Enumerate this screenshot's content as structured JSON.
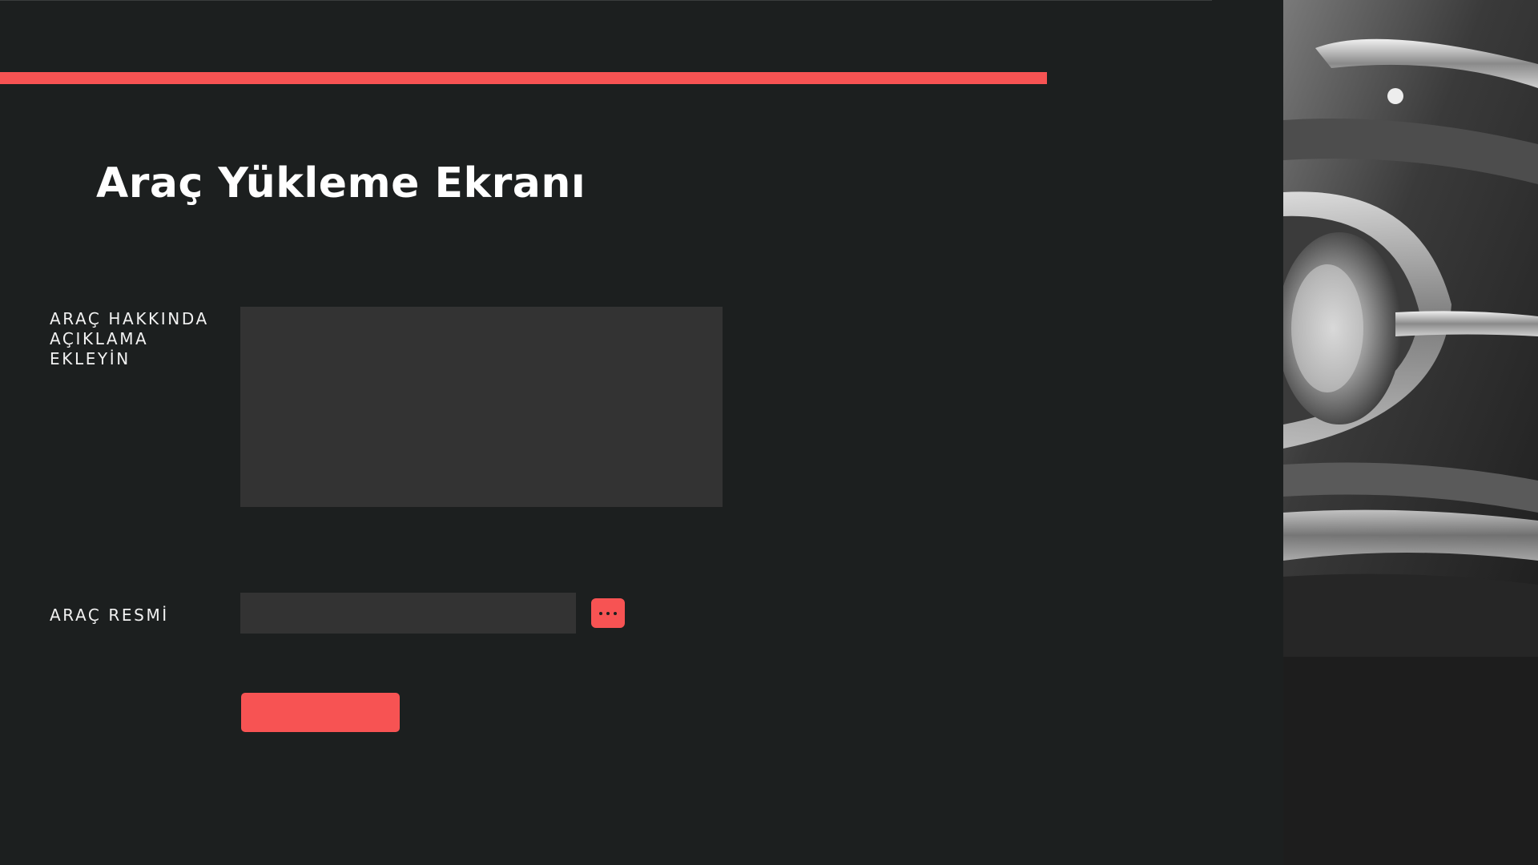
{
  "page": {
    "title": "Araç Yükleme Ekranı"
  },
  "form": {
    "description_label": "ARAÇ HAKKINDA\nAÇIKLAMA\nEKLEYİN",
    "description_value": "",
    "image_label": "ARAÇ RESMİ",
    "image_value": "",
    "browse_icon": "more-dots-icon",
    "submit_label": ""
  },
  "theme": {
    "background": "#1c1f1f",
    "accent": "#f75353",
    "field_background": "#333333",
    "text": "#ffffff"
  },
  "decor": {
    "side_image": "classic-car-photo-grayscale"
  }
}
